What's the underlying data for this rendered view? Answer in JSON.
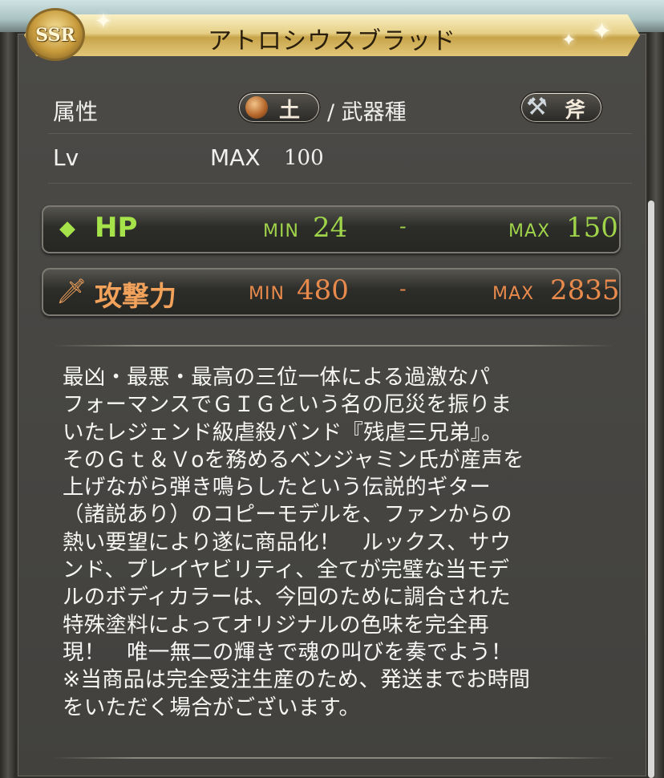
{
  "rarity": "SSR",
  "title": "アトロシウスブラッド",
  "info": {
    "element_label": "属性",
    "element_value": "土",
    "weapon_type_label": "/ 武器種",
    "weapon_type_value": "斧",
    "level_label": "Lv",
    "level_max_text": "MAX",
    "level_max_value": "100"
  },
  "stats": {
    "hp": {
      "name": "HP",
      "min_label": "MIN",
      "min": "24",
      "dash": "-",
      "max_label": "MAX",
      "max": "150"
    },
    "atk": {
      "name": "攻撃力",
      "min_label": "MIN",
      "min": "480",
      "dash": "-",
      "max_label": "MAX",
      "max": "2835"
    }
  },
  "description": "最凶・最悪・最高の三位一体による過激なパ\nフォーマンスでＧＩＧという名の厄災を振りま\nいたレジェンド級虐殺バンド『残虐三兄弟』。\nそのＧｔ＆Ｖoを務めるベンジャミン氏が産声を\n上げながら弾き鳴らしたという伝説的ギター\n（諸説あり）のコピーモデルを、ファンからの\n熱い要望により遂に商品化！　ルックス、サウ\nンド、プレイヤビリティ、全てが完璧な当モデ\nルのボディカラーは、今回のために調合された\n特殊塗料によってオリジナルの色味を完全再\n現！　唯一無二の輝きで魂の叫びを奏でよう！\n※当商品は完全受注生産のため、発送までお時間\nをいただく場合がございます。",
  "colors": {
    "hp_accent": "#a6e34a",
    "atk_accent": "#f2a25a",
    "banner_gold": "#e6cf86"
  },
  "icons": {
    "element": "earth-orb-icon",
    "weapon": "axe-icon",
    "hp": "diamond-icon",
    "atk": "sword-icon"
  }
}
